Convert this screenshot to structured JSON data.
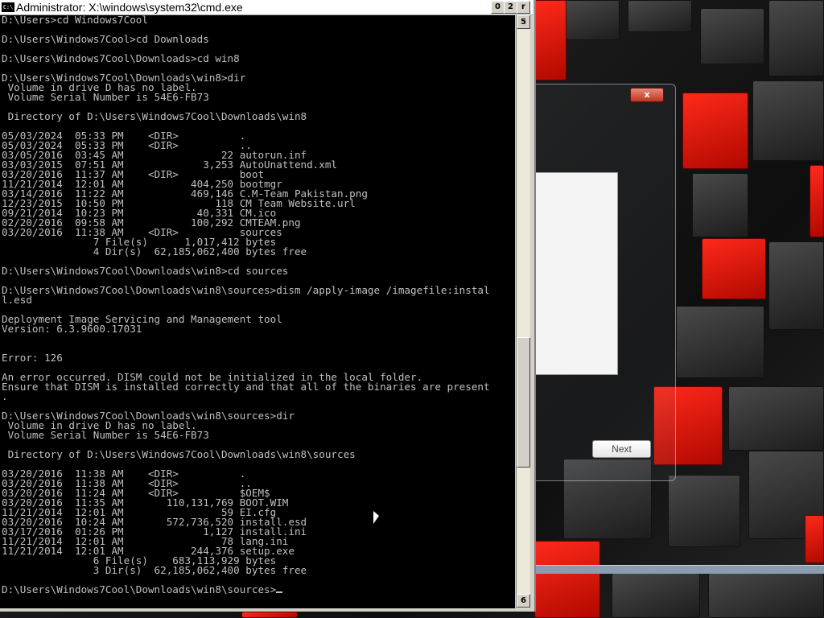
{
  "cmd_window": {
    "title": "Administrator: X:\\windows\\system32\\cmd.exe",
    "icon_text": "C:\\",
    "min_label": "0",
    "max_label": "2",
    "close_label": "r",
    "scroll_up_label": "5",
    "scroll_down_label": "6",
    "lines": [
      "D:\\Users>cd Windows7Cool",
      "",
      "D:\\Users\\Windows7Cool>cd Downloads",
      "",
      "D:\\Users\\Windows7Cool\\Downloads>cd win8",
      "",
      "D:\\Users\\Windows7Cool\\Downloads\\win8>dir",
      " Volume in drive D has no label.",
      " Volume Serial Number is 54E6-FB73",
      "",
      " Directory of D:\\Users\\Windows7Cool\\Downloads\\win8",
      "",
      "05/03/2024  05:33 PM    <DIR>          .",
      "05/03/2024  05:33 PM    <DIR>          ..",
      "03/05/2016  03:45 AM                22 autorun.inf",
      "03/03/2015  07:51 AM             3,253 AutoUnattend.xml",
      "03/20/2016  11:37 AM    <DIR>          boot",
      "11/21/2014  12:01 AM           404,250 bootmgr",
      "03/14/2016  11:22 AM           469,146 C.M-Team Pakistan.png",
      "12/23/2015  10:50 PM               118 CM Team Website.url",
      "09/21/2014  10:23 PM            40,331 CM.ico",
      "02/20/2016  09:58 AM           100,292 CMTEAM.png",
      "03/20/2016  11:38 AM    <DIR>          sources",
      "               7 File(s)      1,017,412 bytes",
      "               4 Dir(s)  62,185,062,400 bytes free",
      "",
      "D:\\Users\\Windows7Cool\\Downloads\\win8>cd sources",
      "",
      "D:\\Users\\Windows7Cool\\Downloads\\win8\\sources>dism /apply-image /imagefile:instal",
      "l.esd",
      "",
      "Deployment Image Servicing and Management tool",
      "Version: 6.3.9600.17031",
      "",
      "",
      "Error: 126",
      "",
      "An error occurred. DISM could not be initialized in the local folder.",
      "Ensure that DISM is installed correctly and that all of the binaries are present",
      ".",
      "",
      "D:\\Users\\Windows7Cool\\Downloads\\win8\\sources>dir",
      " Volume in drive D has no label.",
      " Volume Serial Number is 54E6-FB73",
      "",
      " Directory of D:\\Users\\Windows7Cool\\Downloads\\win8\\sources",
      "",
      "03/20/2016  11:38 AM    <DIR>          .",
      "03/20/2016  11:38 AM    <DIR>          ..",
      "03/20/2016  11:24 AM    <DIR>          $OEM$",
      "03/20/2016  11:35 AM       110,131,769 BOOT.WIM",
      "11/21/2014  12:01 AM                59 EI.cfg",
      "03/20/2016  10:24 AM       572,736,520 install.esd",
      "03/17/2016  01:26 PM             1,127 install.ini",
      "11/21/2014  12:01 AM                78 lang.ini",
      "11/21/2014  12:01 AM           244,376 setup.exe",
      "               6 File(s)    683,113,929 bytes",
      "               3 Dir(s)  62,185,062,400 bytes free",
      ""
    ],
    "prompt": "D:\\Users\\Windows7Cool\\Downloads\\win8\\sources>"
  },
  "setup_window": {
    "close_label": "x",
    "next_label": "Next"
  },
  "colors": {
    "console_bg": "#000000",
    "console_text": "#c0c0c0",
    "accent_red": "#e81a0b"
  }
}
